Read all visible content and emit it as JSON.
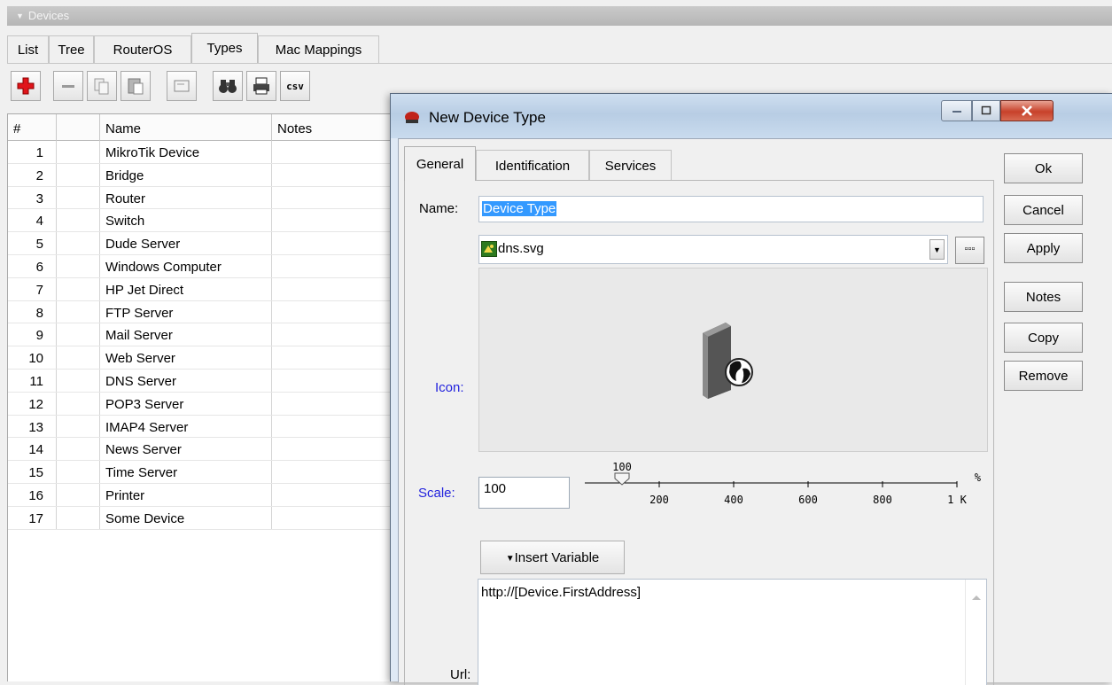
{
  "panel": {
    "title": "Devices",
    "tabs": [
      "List",
      "Tree",
      "RouterOS",
      "Types",
      "Mac Mappings"
    ],
    "active_tab": "Types",
    "toolbar": {
      "add": "add-icon",
      "remove": "remove-icon",
      "copy": "copy-icon",
      "paste": "paste-icon",
      "comment": "comment-icon",
      "find": "binoculars-icon",
      "print": "printer-icon",
      "csv": "csv"
    },
    "table": {
      "columns": [
        "#",
        "",
        "Name",
        "Notes"
      ],
      "rows": [
        {
          "num": "1",
          "name": "MikroTik Device"
        },
        {
          "num": "2",
          "name": "Bridge"
        },
        {
          "num": "3",
          "name": "Router"
        },
        {
          "num": "4",
          "name": "Switch"
        },
        {
          "num": "5",
          "name": "Dude Server"
        },
        {
          "num": "6",
          "name": "Windows Computer"
        },
        {
          "num": "7",
          "name": "HP Jet Direct"
        },
        {
          "num": "8",
          "name": "FTP Server"
        },
        {
          "num": "9",
          "name": "Mail Server"
        },
        {
          "num": "10",
          "name": "Web Server"
        },
        {
          "num": "11",
          "name": "DNS Server"
        },
        {
          "num": "12",
          "name": "POP3 Server"
        },
        {
          "num": "13",
          "name": "IMAP4 Server"
        },
        {
          "num": "14",
          "name": "News Server"
        },
        {
          "num": "15",
          "name": "Time Server"
        },
        {
          "num": "16",
          "name": "Printer"
        },
        {
          "num": "17",
          "name": "Some Device"
        }
      ]
    }
  },
  "dialog": {
    "title": "New Device Type",
    "tabs": [
      "General",
      "Identification",
      "Services"
    ],
    "active_tab": "General",
    "buttons": {
      "ok": "Ok",
      "cancel": "Cancel",
      "apply": "Apply",
      "notes": "Notes",
      "copy": "Copy",
      "remove": "Remove"
    },
    "form": {
      "name_label": "Name:",
      "name_value": "Device Type",
      "icon_label": "Icon:",
      "icon_file": "dns.svg",
      "browse": "▫▫▫",
      "scale_label": "Scale:",
      "scale_value": "100",
      "slider": {
        "value": 100,
        "value_label": "100",
        "ticks": [
          "200",
          "400",
          "600",
          "800",
          "1 K"
        ],
        "unit": "%"
      },
      "insert_variable": "Insert Variable",
      "url_label": "Url:",
      "url_value": "http://[Device.FirstAddress]"
    }
  }
}
